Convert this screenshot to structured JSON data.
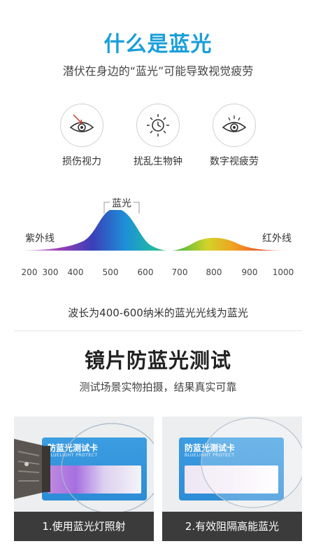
{
  "section1": {
    "title": "什么是蓝光",
    "subtitle": "潜伏在身边的“蓝光”可能导致视觉疲劳",
    "icons": [
      {
        "name": "eye-arrow-icon",
        "label": "损伤视力"
      },
      {
        "name": "sun-clock-icon",
        "label": "扰乱生物钟"
      },
      {
        "name": "digital-eye-icon",
        "label": "数字视疲劳"
      }
    ]
  },
  "spectrum": {
    "peak_label": "蓝光",
    "left_label": "紫外线",
    "right_label": "红外线",
    "ticks": [
      "200",
      "300",
      "400",
      "500",
      "600",
      "700",
      "800",
      "900",
      "1000"
    ]
  },
  "note": "波长为400-600纳米的蓝光光线为蓝光",
  "section2": {
    "title": "镜片防蓝光测试",
    "subtitle": "测试场景实物拍摄，结果真实可靠",
    "card_title": "防蓝光测试卡",
    "card_en": "BLUELIGHT PROTECT",
    "panels": [
      {
        "caption": "1.使用蓝光灯照射"
      },
      {
        "caption": "2.有效阻隔高能蓝光"
      }
    ]
  },
  "colors": {
    "accent": "#1a9fd9",
    "caption_bg": "#3b3b3b"
  }
}
